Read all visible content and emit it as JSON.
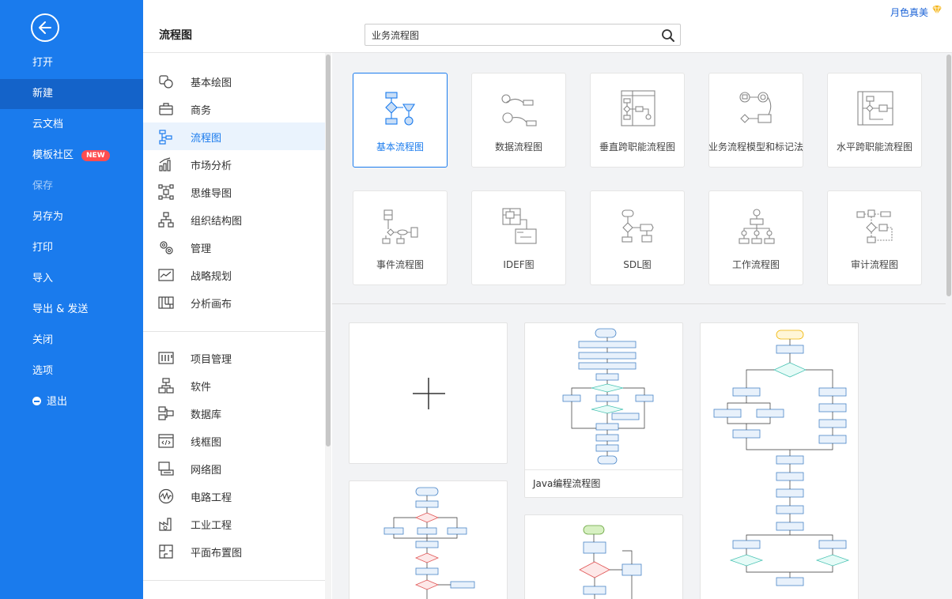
{
  "sidebar": {
    "items": [
      {
        "label": "打开"
      },
      {
        "label": "新建"
      },
      {
        "label": "云文档"
      },
      {
        "label": "模板社区"
      },
      {
        "label": "保存"
      },
      {
        "label": "另存为"
      },
      {
        "label": "打印"
      },
      {
        "label": "导入"
      },
      {
        "label": "导出 & 发送"
      },
      {
        "label": "关闭"
      },
      {
        "label": "选项"
      },
      {
        "label": "退出"
      }
    ],
    "new_badge": "NEW",
    "active": "新建"
  },
  "header": {
    "title": "流程图",
    "search_value": "业务流程图",
    "user_name": "月色真美"
  },
  "categories": {
    "group1": [
      {
        "label": "基本绘图",
        "icon": "shapes-icon"
      },
      {
        "label": "商务",
        "icon": "briefcase-icon"
      },
      {
        "label": "流程图",
        "icon": "flowchart-icon"
      },
      {
        "label": "市场分析",
        "icon": "bar-chart-icon"
      },
      {
        "label": "思维导图",
        "icon": "mindmap-icon"
      },
      {
        "label": "组织结构图",
        "icon": "org-chart-icon"
      },
      {
        "label": "管理",
        "icon": "gears-icon"
      },
      {
        "label": "战略规划",
        "icon": "line-chart-icon"
      },
      {
        "label": "分析画布",
        "icon": "canvas-icon"
      }
    ],
    "group2": [
      {
        "label": "项目管理",
        "icon": "kanban-icon"
      },
      {
        "label": "软件",
        "icon": "software-icon"
      },
      {
        "label": "数据库",
        "icon": "database-icon"
      },
      {
        "label": "线框图",
        "icon": "wireframe-icon"
      },
      {
        "label": "网络图",
        "icon": "network-icon"
      },
      {
        "label": "电路工程",
        "icon": "circuit-icon"
      },
      {
        "label": "工业工程",
        "icon": "industry-icon"
      },
      {
        "label": "平面布置图",
        "icon": "floorplan-icon"
      }
    ],
    "active": "流程图"
  },
  "diagram_types": [
    {
      "label": "基本流程图"
    },
    {
      "label": "数据流程图"
    },
    {
      "label": "垂直跨职能流程图"
    },
    {
      "label": "业务流程模型和标记法"
    },
    {
      "label": "水平跨职能流程图"
    },
    {
      "label": "事件流程图"
    },
    {
      "label": "IDEF图"
    },
    {
      "label": "SDL图"
    },
    {
      "label": "工作流程图"
    },
    {
      "label": "审计流程图"
    }
  ],
  "templates": [
    {
      "title": "Java编程流程图"
    }
  ],
  "colors": {
    "sidebar_bg": "#1a7bed",
    "sidebar_active": "#1463c9",
    "accent": "#1a7bed",
    "badge": "#ff4d4f"
  }
}
